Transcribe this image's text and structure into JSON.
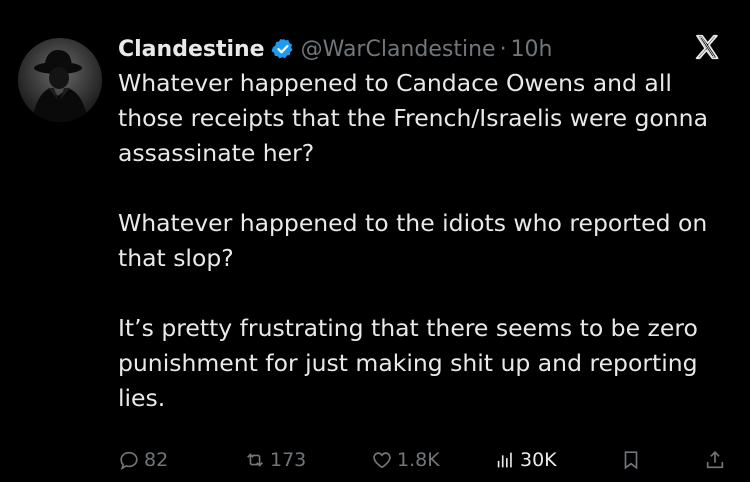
{
  "author": {
    "name": "Clandestine",
    "handle": "@WarClandestine",
    "separator": "·",
    "time": "10h"
  },
  "body": {
    "paragraphs": [
      "Whatever happened to Candace Owens and all those receipts that the French/Israelis were gonna assassinate her?",
      "Whatever happened to the idiots who reported on that slop?",
      "It’s pretty frustrating that there seems to be zero punishment for just making shit up and reporting lies."
    ]
  },
  "actions": {
    "replies": "82",
    "reposts": "173",
    "likes": "1.8K",
    "views": "30K"
  },
  "icons": {
    "verified": "verified-badge-icon",
    "logo": "x-logo-icon",
    "reply": "reply-icon",
    "repost": "repost-icon",
    "like": "heart-icon",
    "views": "views-icon",
    "bookmark": "bookmark-icon",
    "share": "share-icon"
  },
  "colors": {
    "background": "#000000",
    "text": "#e7e9ea",
    "muted": "#71767b",
    "verified": "#1d9bf0"
  }
}
